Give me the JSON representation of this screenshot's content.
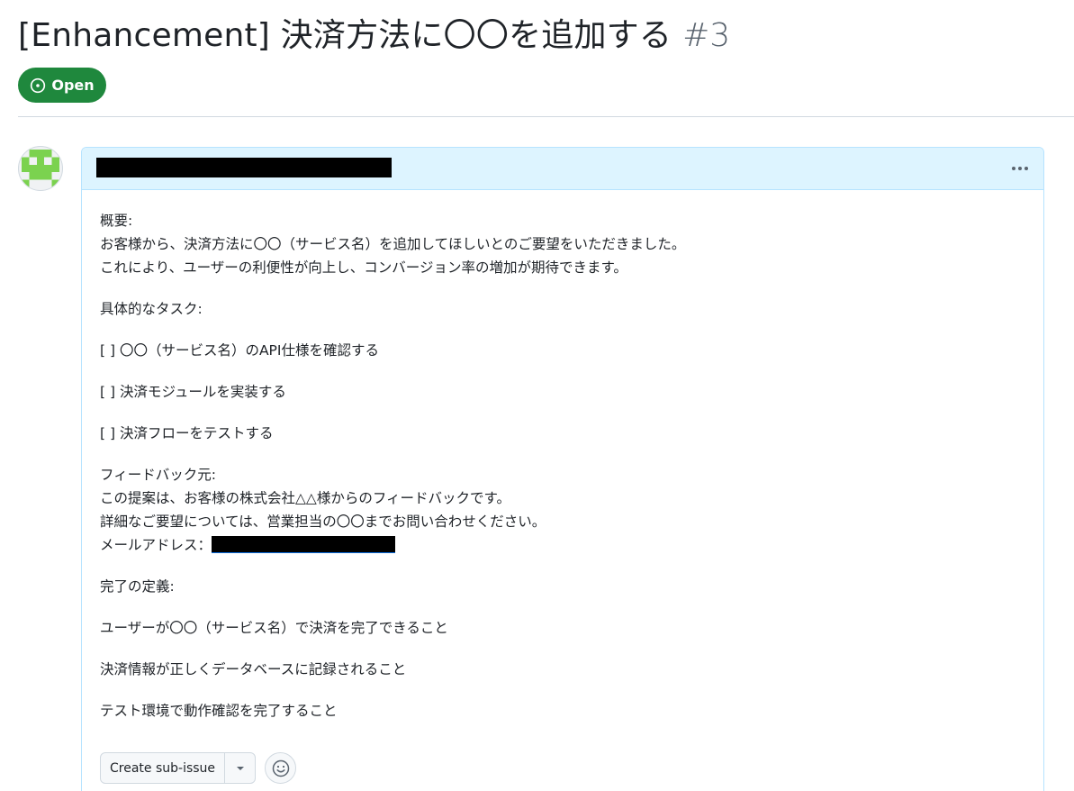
{
  "issue": {
    "title": "[Enhancement] 決済方法に〇〇を追加する",
    "number": "#3",
    "state_label": "Open",
    "state_color": "#1f883d"
  },
  "comment": {
    "body": {
      "overview": {
        "heading": "概要:",
        "lines": [
          "お客様から、決済方法に〇〇（サービス名）を追加してほしいとのご要望をいただきました。",
          "これにより、ユーザーの利便性が向上し、コンバージョン率の増加が期待できます。"
        ]
      },
      "tasks_heading": "具体的なタスク:",
      "tasks": [
        "[ ] 〇〇（サービス名）のAPI仕様を確認する",
        "[ ] 決済モジュールを実装する",
        "[ ] 決済フローをテストする"
      ],
      "feedback": {
        "heading": "フィードバック元:",
        "lines": [
          "この提案は、お客様の株式会社△△様からのフィードバックです。",
          "詳細なご要望については、営業担当の〇〇までお問い合わせください。"
        ],
        "email_label": "メールアドレス："
      },
      "done_heading": "完了の定義:",
      "done": [
        "ユーザーが〇〇（サービス名）で決済を完了できること",
        "決済情報が正しくデータベースに記録されること",
        "テスト環境で動作確認を完了すること"
      ]
    },
    "actions": {
      "create_sub_issue": "Create sub-issue",
      "caret_icon": "triangle-down-icon",
      "reaction_icon": "smiley-icon"
    }
  },
  "icons": {
    "state_icon": "issue-opened-icon",
    "menu_icon": "kebab-horizontal-icon"
  },
  "colors": {
    "header_bg": "#ddf4ff",
    "border": "#b6e3ff",
    "avatar_green": "#7bd24f"
  }
}
